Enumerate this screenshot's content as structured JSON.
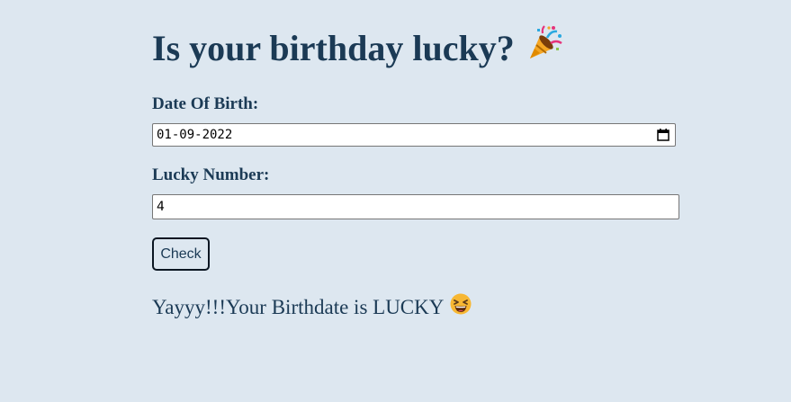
{
  "page": {
    "title": "Is your birthday lucky?",
    "title_icon": "party-popper-icon"
  },
  "form": {
    "dob_label": "Date Of Birth:",
    "dob_value": "01-09-2022",
    "lucky_label": "Lucky Number:",
    "lucky_value": "4",
    "check_label": "Check"
  },
  "result": {
    "message": "Yayyy!!!Your Birthdate is LUCKY",
    "icon": "grinning-squinting-face-icon"
  },
  "colors": {
    "background": "#dde7f0",
    "text": "#1b3a55",
    "button_border": "#0b1622"
  }
}
